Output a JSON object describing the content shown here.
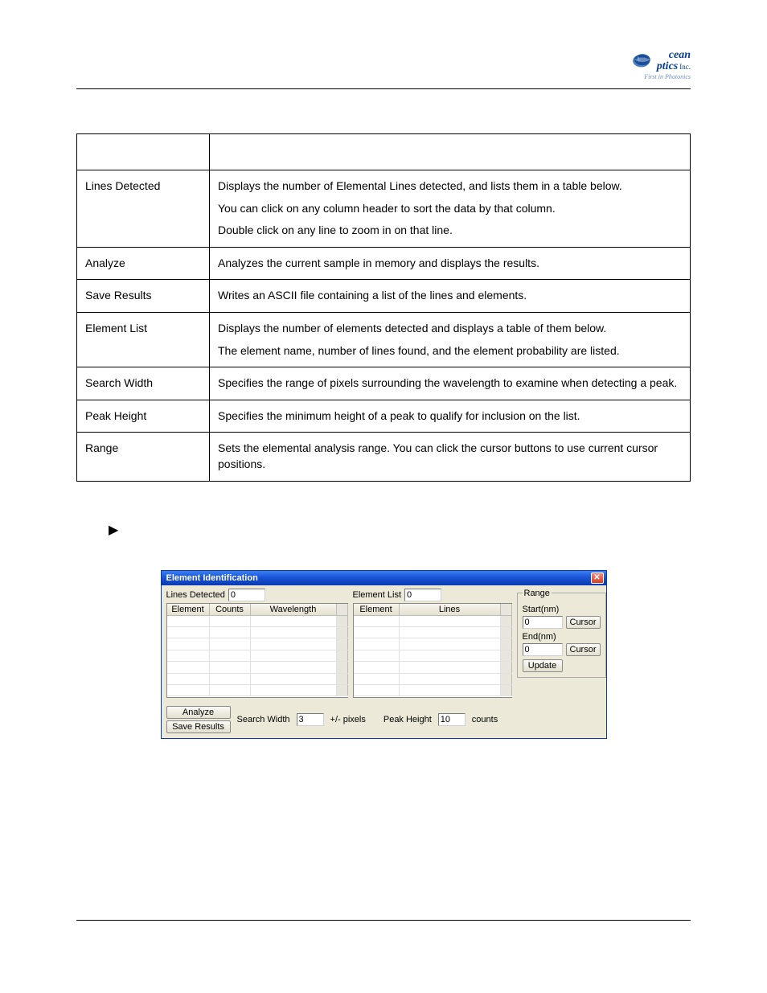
{
  "logo": {
    "line1": "cean",
    "line2": "ptics",
    "suffix": "Inc.",
    "tagline": "First in Photonics"
  },
  "doc_table": {
    "rows": [
      {
        "term": "Lines Detected",
        "paras": [
          "Displays the number of Elemental Lines detected, and lists them in a table below.",
          "You can click on any column header to sort the data by that column.",
          "Double click on any line to zoom in on that line."
        ]
      },
      {
        "term": "Analyze",
        "paras": [
          "Analyzes the current sample in memory and displays the results."
        ]
      },
      {
        "term": "Save Results",
        "paras": [
          "Writes an ASCII file containing a list of the lines and elements."
        ]
      },
      {
        "term": "Element List",
        "paras": [
          "Displays the number of elements detected and displays a table of them below.",
          "The element name, number of lines found, and the element probability are listed."
        ]
      },
      {
        "term": "Search Width",
        "paras": [
          "Specifies the range of pixels surrounding the wavelength to examine when detecting a peak."
        ]
      },
      {
        "term": "Peak Height",
        "paras": [
          "Specifies the minimum height of a peak to qualify for inclusion on the list."
        ]
      },
      {
        "term": "Range",
        "paras": [
          "Sets the elemental analysis range. You can click the cursor buttons to use current cursor positions."
        ]
      }
    ]
  },
  "procedure_marker": "▶",
  "dialog": {
    "title": "Element Identification",
    "lines_detected_label": "Lines Detected",
    "lines_detected_value": "0",
    "lines_cols": {
      "c1": "Element",
      "c2": "Counts",
      "c3": "Wavelength"
    },
    "element_list_label": "Element List",
    "element_list_value": "0",
    "el_cols": {
      "c1": "Element",
      "c2": "Lines"
    },
    "analyze_btn": "Analyze",
    "save_btn": "Save Results",
    "search_width_label": "Search Width",
    "search_width_value": "3",
    "search_width_unit": "+/- pixels",
    "peak_height_label": "Peak Height",
    "peak_height_value": "10",
    "peak_height_unit": "counts",
    "range": {
      "legend": "Range",
      "start_label": "Start(nm)",
      "start_value": "0",
      "end_label": "End(nm)",
      "end_value": "0",
      "cursor_btn": "Cursor",
      "update_btn": "Update"
    }
  }
}
